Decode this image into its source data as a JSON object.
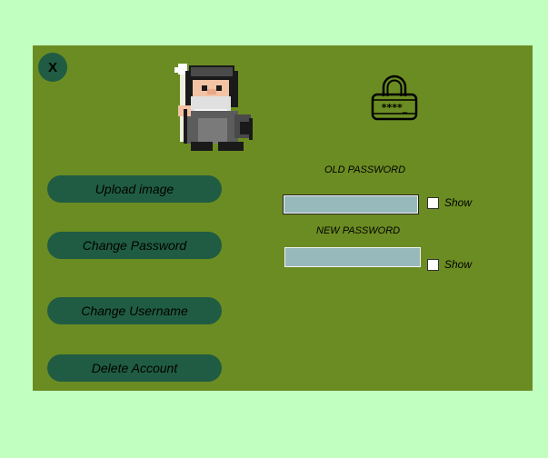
{
  "window": {
    "close_label": "X"
  },
  "icons": {
    "avatar": "wizard-avatar-icon",
    "lock": "password-lock-icon",
    "lock_text": "****_"
  },
  "sidebar": {
    "upload_image": "Upload image",
    "change_password": "Change Password",
    "change_username": "Change Username",
    "delete_account": "Delete Account"
  },
  "form": {
    "old_password_label": "OLD PASSWORD",
    "old_password_value": "",
    "new_password_label": "NEW PASSWORD",
    "new_password_value": "",
    "show_label_old": "Show",
    "show_label_new": "Show",
    "show_old_checked": false,
    "show_new_checked": false
  },
  "colors": {
    "page_background": "#c0ffc0",
    "panel_background": "#6b8c22",
    "button_background": "#1f5c43",
    "input_background": "#98b9bb"
  }
}
